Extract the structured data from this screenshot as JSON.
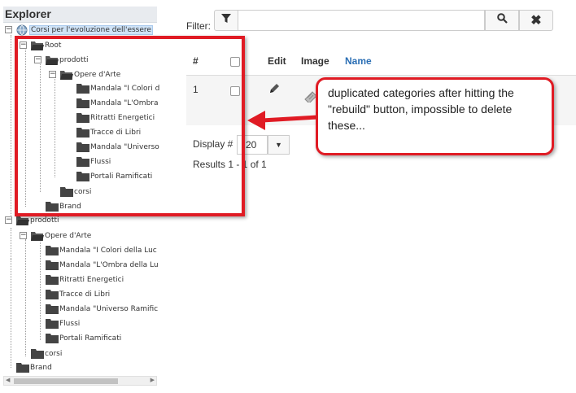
{
  "explorer": {
    "title": "Explorer",
    "root_label": "Corsi per l'evoluzione dell'essere",
    "group1": {
      "root": "Root",
      "prodotti": "prodotti",
      "opere": "Opere d'Arte",
      "items": [
        "Mandala \"I Colori d",
        "Mandala \"L'Ombra",
        "Ritratti Energetici",
        "Tracce di Libri",
        "Mandala \"Universo",
        "Flussi",
        "Portali Ramificati"
      ],
      "corsi": "corsi",
      "brand": "Brand"
    },
    "group2": {
      "prodotti": "prodotti",
      "opere": "Opere d'Arte",
      "items": [
        "Mandala \"I Colori della Luc",
        "Mandala \"L'Ombra della Lu",
        "Ritratti Energetici",
        "Tracce di Libri",
        "Mandala \"Universo Ramific",
        "Flussi",
        "Portali Ramificati"
      ],
      "corsi": "corsi",
      "brand": "Brand"
    }
  },
  "filter": {
    "label": "Filter:",
    "value": "",
    "placeholder": "",
    "filter_icon": "funnel-icon",
    "search_icon": "magnifier-icon",
    "clear_icon": "x-icon",
    "clear_label": "✖"
  },
  "table": {
    "headers": {
      "num": "#",
      "edit": "Edit",
      "image": "Image",
      "name": "Name"
    },
    "rows": [
      {
        "num": "1",
        "edit_icon": "pencil-icon",
        "image_icon": "stamp-icon"
      }
    ]
  },
  "pagination": {
    "display_label": "Display #",
    "display_value": "20",
    "caret": "▼",
    "results": "Results 1 - 1 of 1"
  },
  "annotation": {
    "text": "duplicated categories after hitting the \"rebuild\" button, impossible to delete these...",
    "color": "#e01b24"
  }
}
